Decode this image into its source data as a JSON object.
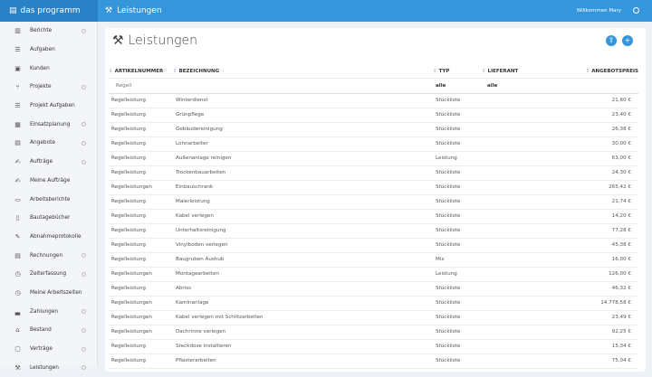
{
  "app": {
    "name": "das programm",
    "page": "Leistungen",
    "welcome": "Willkommen Mary"
  },
  "sidebar": {
    "items": [
      {
        "label": "Berichte",
        "icon": "chart-icon",
        "info": true
      },
      {
        "label": "Aufgaben",
        "icon": "list-icon",
        "info": false
      },
      {
        "label": "Kunden",
        "icon": "contact-icon",
        "info": false
      },
      {
        "label": "Projekte",
        "icon": "hierarchy-icon",
        "info": true
      },
      {
        "label": "Projekt Aufgaben",
        "icon": "list-icon",
        "info": false
      },
      {
        "label": "Einsatzplanung",
        "icon": "calendar-icon",
        "info": true
      },
      {
        "label": "Angebote",
        "icon": "calculator-icon",
        "info": true
      },
      {
        "label": "Aufträge",
        "icon": "signature-icon",
        "info": true
      },
      {
        "label": "Meine Aufträge",
        "icon": "signature-icon",
        "info": false
      },
      {
        "label": "Arbeitsberichte",
        "icon": "report-icon",
        "info": false
      },
      {
        "label": "Bautagebücher",
        "icon": "book-icon",
        "info": false
      },
      {
        "label": "Abnahmeprotokolle",
        "icon": "protocol-icon",
        "info": false
      },
      {
        "label": "Rechnungen",
        "icon": "invoice-icon",
        "info": true
      },
      {
        "label": "Zeiterfassung",
        "icon": "clock-icon",
        "info": true
      },
      {
        "label": "Meine Arbeitszeiten",
        "icon": "clock-icon",
        "info": false
      },
      {
        "label": "Zahlungen",
        "icon": "cash-register-icon",
        "info": true
      },
      {
        "label": "Bestand",
        "icon": "warehouse-icon",
        "info": true
      },
      {
        "label": "Verträge",
        "icon": "contract-icon",
        "info": true
      },
      {
        "label": "Leistungen",
        "icon": "hammer-icon",
        "info": true
      }
    ]
  },
  "table": {
    "headers": [
      "ARTIKELNUMMER",
      "BEZEICHNUNG",
      "TYP",
      "LIEFERANT",
      "ANGEBOTSPREIS"
    ],
    "filters": {
      "artikelnummer": "Regell",
      "typ": "alle",
      "lieferant": "alle"
    },
    "rows": [
      [
        "Regelleistung",
        "Winterdienst",
        "Stückliste",
        "",
        "21,60 €"
      ],
      [
        "Regelleistung",
        "Grünpflege",
        "Stückliste",
        "",
        "23,40 €"
      ],
      [
        "Regelleistung",
        "Gebäudereinigung",
        "Stückliste",
        "",
        "26,38 €"
      ],
      [
        "Regelleistung",
        "Lohnarbeiter",
        "Stückliste",
        "",
        "30,00 €"
      ],
      [
        "Regelleistung",
        "Außenanlage reinigen",
        "Leistung",
        "",
        "63,00 €"
      ],
      [
        "Regelleistung",
        "Trockenbauarbeiten",
        "Stückliste",
        "",
        "24,30 €"
      ],
      [
        "Regelleistungen",
        "Einbauschrank",
        "Stückliste",
        "",
        "265,42 €"
      ],
      [
        "Regelleistung",
        "Malerleistung",
        "Stückliste",
        "",
        "21,74 €"
      ],
      [
        "Regelleistung",
        "Kabel verlegen",
        "Stückliste",
        "",
        "14,20 €"
      ],
      [
        "Regelleistung",
        "Unterhaltsreinigung",
        "Stückliste",
        "",
        "77,28 €"
      ],
      [
        "Regelleistung",
        "Vinylboden verlegen",
        "Stückliste",
        "",
        "45,38 €"
      ],
      [
        "Regelleistung",
        "Baugruben Aushub",
        "Mix",
        "",
        "16,00 €"
      ],
      [
        "Regelleistungen",
        "Montagearbeiten",
        "Leistung",
        "",
        "126,00 €"
      ],
      [
        "Regelleistung",
        "Abriss",
        "Stückliste",
        "",
        "46,32 €"
      ],
      [
        "Regelleistungen",
        "Kaminanlage",
        "Stückliste",
        "",
        "14.778,58 €"
      ],
      [
        "Regelleistungen",
        "Kabel verlegen mit Schlitzarbeiten",
        "Stückliste",
        "",
        "23,49 €"
      ],
      [
        "Regelleistungen",
        "Dachrinne verlegen",
        "Stückliste",
        "",
        "92,25 €"
      ],
      [
        "Regelleistung",
        "Steckdose installieren",
        "Stückliste",
        "",
        "15,34 €"
      ],
      [
        "Regelleistung",
        "Pflasterarbeiten",
        "Stückliste",
        "",
        "75,04 €"
      ]
    ]
  },
  "colors": {
    "primary": "#3596dc",
    "logo_bg": "#2a82c6"
  }
}
